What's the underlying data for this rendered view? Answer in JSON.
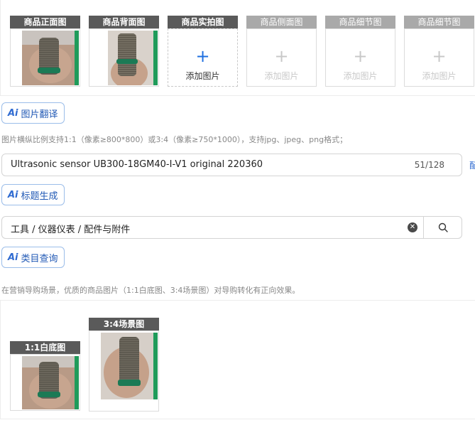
{
  "image_slots": [
    {
      "label": "商品正面图",
      "state": "filled"
    },
    {
      "label": "商品背面图",
      "state": "filled"
    },
    {
      "label": "商品实拍图",
      "state": "add",
      "add_text": "添加图片"
    },
    {
      "label": "商品侧面图",
      "state": "disabled",
      "add_text": "添加图片"
    },
    {
      "label": "商品细节图",
      "state": "disabled",
      "add_text": "添加图片"
    },
    {
      "label": "商品细节图",
      "state": "disabled",
      "add_text": "添加图片"
    }
  ],
  "ai_image_translate": {
    "icon": "Ai",
    "label": "图片翻译"
  },
  "image_hint": "图片横纵比例支持1:1（像素≥800*800）或3:4（像素≥750*1000），支持jpg、jpeg、png格式；",
  "title_field": {
    "value": "Ultrasonic sensor UB300-18GM40-I-V1 original 220360",
    "counter": "51/128"
  },
  "side_glyph": "配",
  "ai_title_generate": {
    "icon": "Ai",
    "label": "标题生成"
  },
  "category_field": {
    "value": "工具 / 仪器仪表 / 配件与附件",
    "clear_icon": "close-circle-icon",
    "search_icon": "search-icon"
  },
  "ai_category_query": {
    "icon": "Ai",
    "label": "类目查询"
  },
  "guide_hint": "在营销导购场景，优质的商品图片（1:1白底图、3:4场景图）对导购转化有正向效果。",
  "guide_images": [
    {
      "label": "1:1白底图"
    },
    {
      "label": "3:4场景图"
    }
  ],
  "colors": {
    "accent": "#1e6fe0",
    "ai_border": "#9bbde9",
    "label_dark": "#5a5a5a",
    "label_light": "#a9a9a9"
  }
}
